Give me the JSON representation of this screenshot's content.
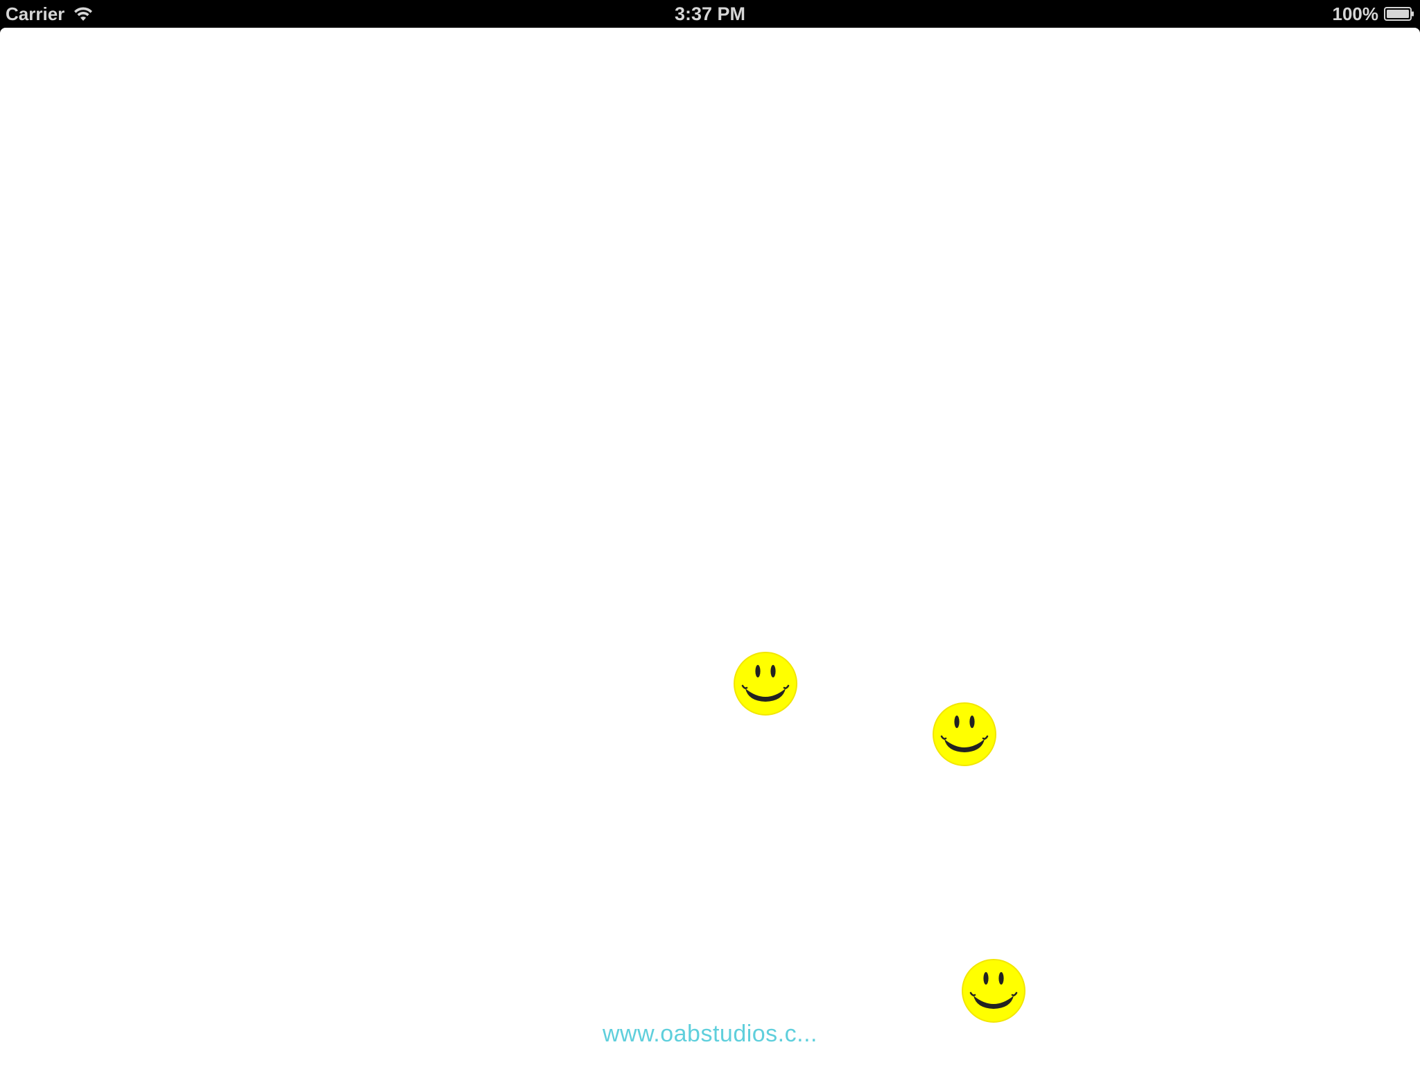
{
  "status_bar": {
    "carrier": "Carrier",
    "time": "3:37 PM",
    "battery_percent": "100%",
    "battery_level": 1.0,
    "icons": [
      "wifi-icon",
      "battery-icon"
    ]
  },
  "main": {
    "background_color": "#ffffff",
    "smileys": [
      {
        "name": "smiley-1",
        "icon": "smiley-face-icon",
        "color": "#ffff00"
      },
      {
        "name": "smiley-2",
        "icon": "smiley-face-icon",
        "color": "#ffff00"
      },
      {
        "name": "smiley-3",
        "icon": "smiley-face-icon",
        "color": "#ffff00"
      }
    ],
    "website_link": "www.oabstudios.c...",
    "link_color": "#5fcfdc"
  }
}
